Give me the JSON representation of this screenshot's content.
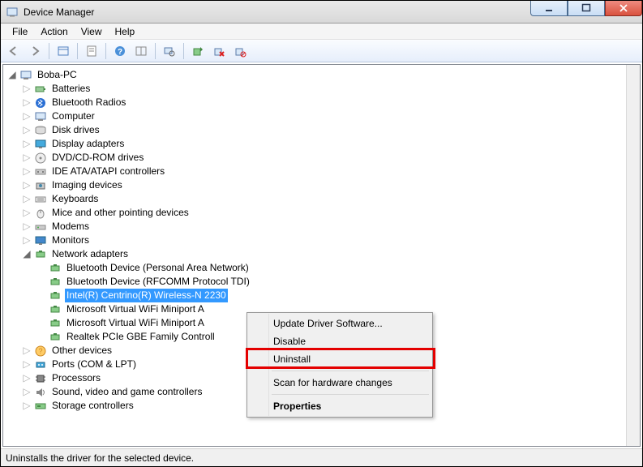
{
  "title": "Device Manager",
  "menus": [
    "File",
    "Action",
    "View",
    "Help"
  ],
  "statusbar": "Uninstalls the driver for the selected device.",
  "root": "Boba-PC",
  "categories": [
    {
      "label": "Batteries",
      "icon": "battery"
    },
    {
      "label": "Bluetooth Radios",
      "icon": "bluetooth"
    },
    {
      "label": "Computer",
      "icon": "computer"
    },
    {
      "label": "Disk drives",
      "icon": "disk"
    },
    {
      "label": "Display adapters",
      "icon": "display"
    },
    {
      "label": "DVD/CD-ROM drives",
      "icon": "cd"
    },
    {
      "label": "IDE ATA/ATAPI controllers",
      "icon": "ide"
    },
    {
      "label": "Imaging devices",
      "icon": "imaging"
    },
    {
      "label": "Keyboards",
      "icon": "keyboard"
    },
    {
      "label": "Mice and other pointing devices",
      "icon": "mouse"
    },
    {
      "label": "Modems",
      "icon": "modem"
    },
    {
      "label": "Monitors",
      "icon": "monitor"
    }
  ],
  "network_cat": "Network adapters",
  "network_children": [
    "Bluetooth Device (Personal Area Network)",
    "Bluetooth Device (RFCOMM Protocol TDI)",
    "Intel(R) Centrino(R) Wireless-N 2230",
    "Microsoft Virtual WiFi Miniport A",
    "Microsoft Virtual WiFi Miniport A",
    "Realtek PCIe GBE Family Controll"
  ],
  "after_categories": [
    {
      "label": "Other devices",
      "icon": "other"
    },
    {
      "label": "Ports (COM & LPT)",
      "icon": "ports"
    },
    {
      "label": "Processors",
      "icon": "cpu"
    },
    {
      "label": "Sound, video and game controllers",
      "icon": "sound"
    },
    {
      "label": "Storage controllers",
      "icon": "storage"
    }
  ],
  "context_menu": {
    "update": "Update Driver Software...",
    "disable": "Disable",
    "uninstall": "Uninstall",
    "scan": "Scan for hardware changes",
    "properties": "Properties"
  }
}
